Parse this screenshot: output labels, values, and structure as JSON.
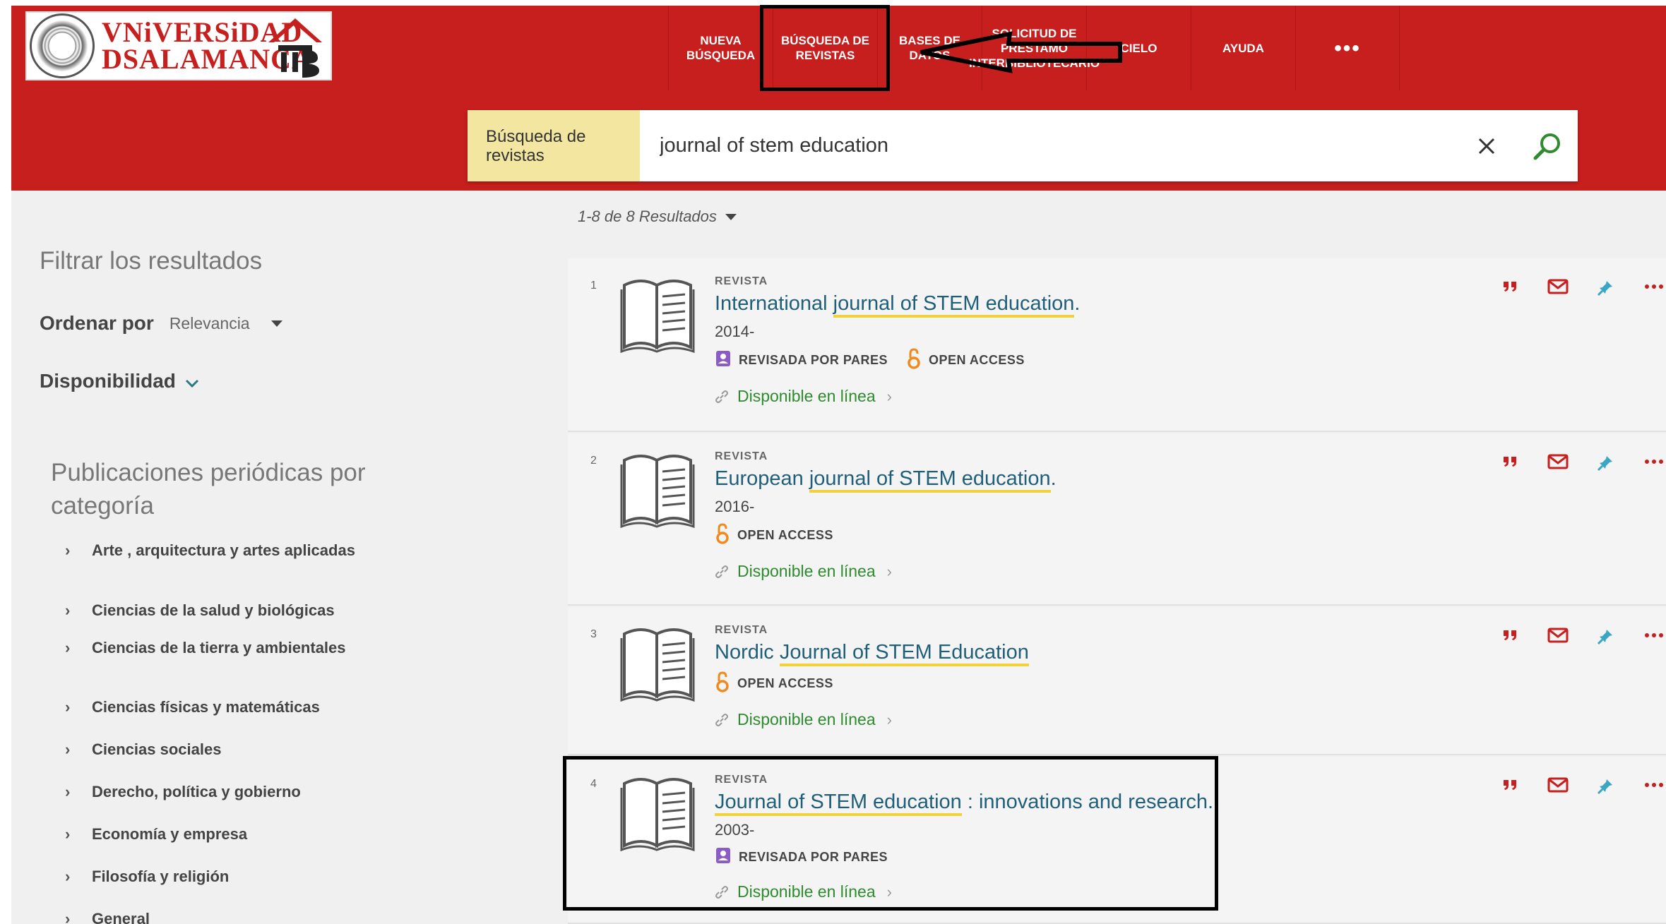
{
  "logo": {
    "line1": "VNiVERSiDAD",
    "line2": "DSALAMANCA"
  },
  "nav": {
    "items": [
      {
        "label": "NUEVA BÚSQUEDA"
      },
      {
        "label": "BÚSQUEDA DE REVISTAS"
      },
      {
        "label": "BASES DE DATOS"
      },
      {
        "label": "SOLICITUD DE PRÉSTAMO INTERBIBLIOTECARIO"
      },
      {
        "label": "CIELO"
      },
      {
        "label": "AYUDA"
      },
      {
        "label": "•••"
      }
    ]
  },
  "search": {
    "scope_label": "Búsqueda de revistas",
    "query": "journal of stem education"
  },
  "sidebar": {
    "filter_title": "Filtrar los resultados",
    "sort_label": "Ordenar por",
    "sort_value": "Relevancia",
    "availability_label": "Disponibilidad",
    "categories_title": "Publicaciones periódicas por categoría",
    "categories": [
      "Arte , arquitectura y artes aplicadas",
      "Ciencias de la salud y biológicas",
      "Ciencias de la tierra y ambientales",
      "Ciencias físicas y matemáticas",
      "Ciencias sociales",
      "Derecho, política y gobierno",
      "Economía y empresa",
      "Filosofía y religión",
      "General"
    ]
  },
  "results": {
    "count_label": "1-8 de 8 Resultados",
    "items": [
      {
        "num": "1",
        "type": "REVISTA",
        "title_pre": "International ",
        "title_hl": "journal of STEM education",
        "title_post": ".",
        "year": "2014-",
        "peer": "REVISADA POR PARES",
        "oa": "OPEN ACCESS",
        "avail": "Disponible en línea"
      },
      {
        "num": "2",
        "type": "REVISTA",
        "title_pre": "European ",
        "title_hl": "journal of STEM education",
        "title_post": ".",
        "year": "2016-",
        "peer": "",
        "oa": "OPEN ACCESS",
        "avail": "Disponible en línea"
      },
      {
        "num": "3",
        "type": "REVISTA",
        "title_pre": "Nordic ",
        "title_hl": "Journal of STEM Education",
        "title_post": "",
        "year": "",
        "peer": "",
        "oa": "OPEN ACCESS",
        "avail": "Disponible en línea"
      },
      {
        "num": "4",
        "type": "REVISTA",
        "title_pre": "",
        "title_hl": "Journal of STEM education",
        "title_post": " : innovations and research.",
        "year": "2003-",
        "peer": "REVISADA POR PARES",
        "oa": "",
        "avail": "Disponible en línea"
      }
    ]
  },
  "colors": {
    "brand_red": "#c71e1e",
    "link": "#1f5f7a",
    "available": "#2e8b2e",
    "highlight": "#f1d23a",
    "action_red": "#c71e1e",
    "pin_blue": "#3aa6c6"
  }
}
